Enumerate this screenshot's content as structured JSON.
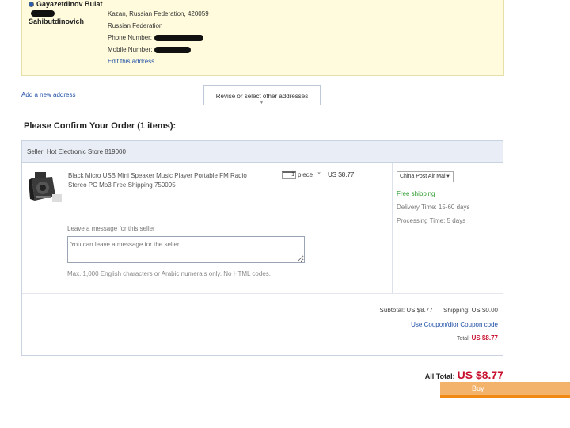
{
  "address": {
    "name_line1": "Gayazetdinov Bulat",
    "name_line2": "Sahibutdinovich",
    "city_line": "Kazan, Russian Federation, 420059",
    "country": "Russian Federation",
    "phone_label": "Phone Number:",
    "mobile_label": "Mobile Number:",
    "edit_link": "Edit this address"
  },
  "tabs": {
    "add_new": "Add a new address",
    "revise": "Revise or select other addresses"
  },
  "order": {
    "title": "Please Confirm Your Order (1 items):",
    "seller": "Seller: Hot Electronic Store 819000",
    "product": {
      "title": "Black Micro USB Mini Speaker Music Player Portable FM Radio Stereo PC Mp3 Free Shipping 750095",
      "quantity": "1",
      "unit": "piece",
      "times": "×",
      "unit_price": "US $8.77"
    },
    "shipping": {
      "method": "China Post Air Mail",
      "free": "Free shipping",
      "delivery_time": "Delivery Time: 15-60 days",
      "processing_time": "Processing Time: 5 days"
    },
    "message": {
      "label": "Leave a message for this seller",
      "placeholder": "You can leave a message for the seller",
      "hint": "Max. 1,000 English characters or Arabic numerals only. No HTML codes."
    },
    "summary": {
      "subtotal_label": "Subtotal:",
      "subtotal_value": "US $8.77",
      "shipping_label": "Shipping:",
      "shipping_value": "US $0.00",
      "coupon_link": "Use Coupon/dior Coupon code",
      "total_label": "Total:",
      "total_value": "US $8.77"
    }
  },
  "all_total": {
    "label": "All Total:",
    "value": "US $8.77"
  },
  "place_order_label": "Buy",
  "colors": {
    "accent_link": "#1f4fa6",
    "price_red": "#c8102e",
    "free_green": "#2d9a2d",
    "button_orange": "#f08a12"
  }
}
